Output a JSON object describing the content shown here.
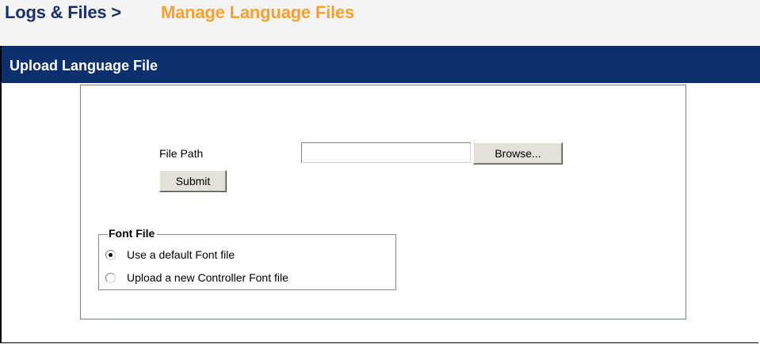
{
  "breadcrumb": {
    "root": "Logs & Files >",
    "current": "Manage Language Files"
  },
  "section": {
    "title": "Upload Language File"
  },
  "form": {
    "file_path_label": "File Path",
    "file_path_value": "",
    "browse_label": "Browse...",
    "submit_label": "Submit"
  },
  "font_file": {
    "legend": "Font File",
    "options": [
      {
        "label": "Use a default Font file",
        "selected": true
      },
      {
        "label": "Upload a new Controller Font file",
        "selected": false
      }
    ]
  },
  "colors": {
    "header_bar": "#0c2f6e",
    "breadcrumb_root": "#1a2f6e",
    "breadcrumb_current": "#f6a130"
  }
}
